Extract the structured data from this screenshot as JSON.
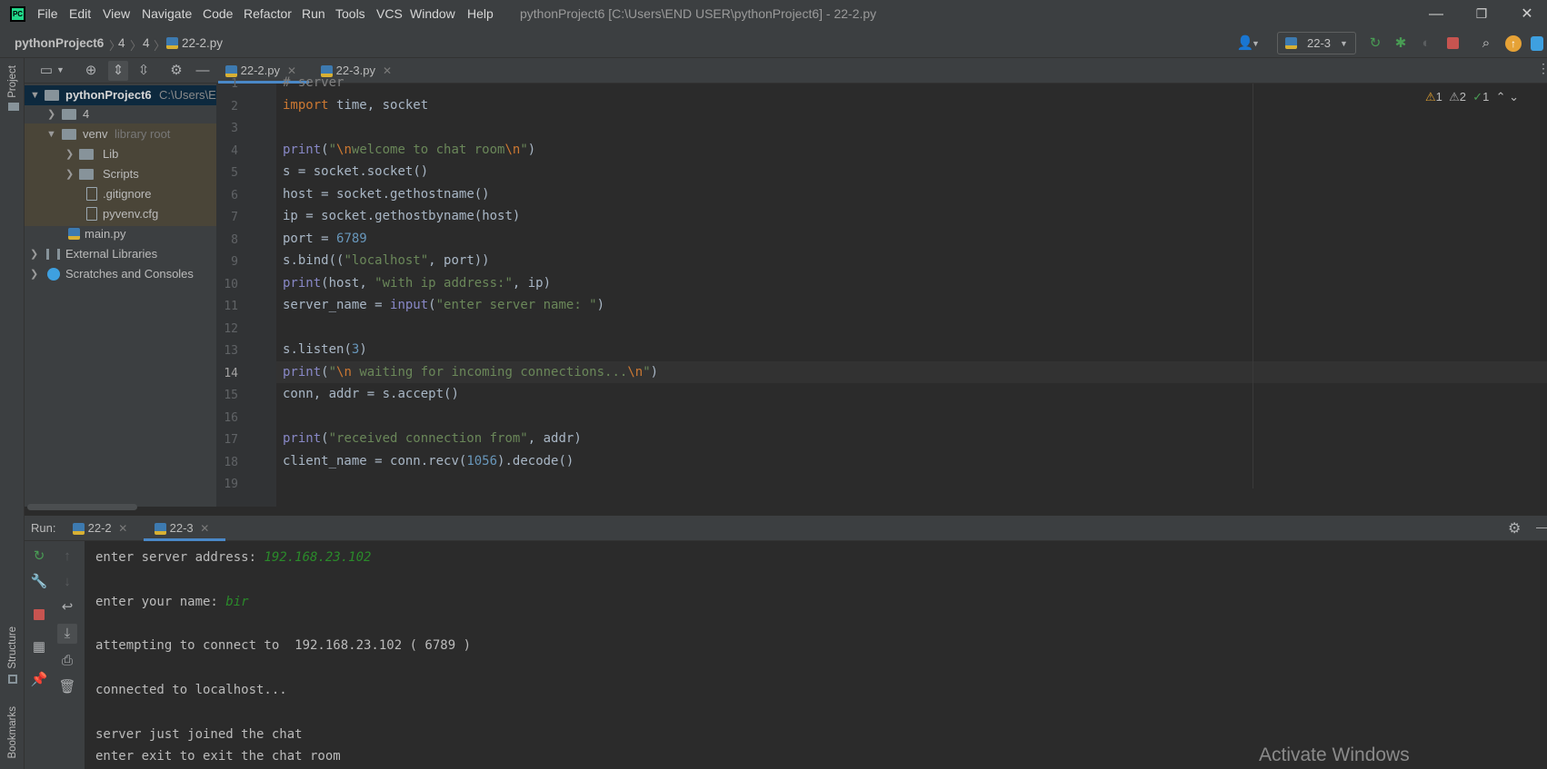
{
  "titlebar": {
    "logo": "PC",
    "menu": [
      "File",
      "Edit",
      "View",
      "Navigate",
      "Code",
      "Refactor",
      "Run",
      "Tools",
      "VCS",
      "Window",
      "Help"
    ],
    "window_title": "pythonProject6 [C:\\Users\\END USER\\pythonProject6] - 22-2.py",
    "minimize": "—",
    "restore": "❐",
    "close": "✕"
  },
  "navbar": {
    "crumbs": [
      "pythonProject6",
      "4",
      "4",
      "22-2.py"
    ],
    "run_config": "22-3"
  },
  "sidebar_labels": {
    "project": "Project",
    "structure": "Structure",
    "bookmarks": "Bookmarks"
  },
  "project_tree": [
    {
      "label": "pythonProject6",
      "suffix": "C:\\Users\\EN"
    },
    {
      "label": "4"
    },
    {
      "label": "venv",
      "suffix": "library root"
    },
    {
      "label": "Lib"
    },
    {
      "label": "Scripts"
    },
    {
      "label": ".gitignore"
    },
    {
      "label": "pyvenv.cfg"
    },
    {
      "label": "main.py"
    },
    {
      "label": "External Libraries"
    },
    {
      "label": "Scratches and Consoles"
    }
  ],
  "editor": {
    "tabs": [
      {
        "label": "22-2.py"
      },
      {
        "label": "22-3.py"
      }
    ],
    "inspections": {
      "warnings": "1",
      "weak": "2",
      "ok": "1"
    },
    "line_numbers": [
      "1",
      "2",
      "3",
      "4",
      "5",
      "6",
      "7",
      "8",
      "9",
      "10",
      "11",
      "12",
      "13",
      "14",
      "15",
      "16",
      "17",
      "18",
      "19"
    ],
    "lines": [
      "# server",
      "import time, socket",
      "",
      "print(\"\\nwelcome to chat room\\n\")",
      "s = socket.socket()",
      "host = socket.gethostname()",
      "ip = socket.gethostbyname(host)",
      "port = 6789",
      "s.bind((\"localhost\", port))",
      "print(host, \"with ip address:\", ip)",
      "server_name = input(\"enter server name: \")",
      "",
      "s.listen(3)",
      "print(\"\\n waiting for incoming connections...\\n\")",
      "conn, addr = s.accept()",
      "",
      "print(\"received connection from\", addr)",
      "client_name = conn.recv(1056).decode()",
      ""
    ]
  },
  "run": {
    "label": "Run:",
    "tabs": [
      {
        "label": "22-2"
      },
      {
        "label": "22-3"
      }
    ],
    "console": [
      {
        "text": "enter server address: ",
        "input": "192.168.23.102"
      },
      {
        "text": "enter your name: ",
        "input": "bir"
      },
      {
        "text": "attempting to connect to  192.168.23.102 ( 6789 )"
      },
      {
        "text": "connected to localhost..."
      },
      {
        "text": "server just joined the chat"
      },
      {
        "text": "enter exit to exit the chat room"
      }
    ]
  },
  "watermark": "Activate Windows",
  "colors": {
    "accent": "#4a88c7",
    "keyword": "#cc7832",
    "string": "#6a8759",
    "number": "#6897bb",
    "builtin": "#8888c6",
    "input": "#2a8a2a"
  }
}
